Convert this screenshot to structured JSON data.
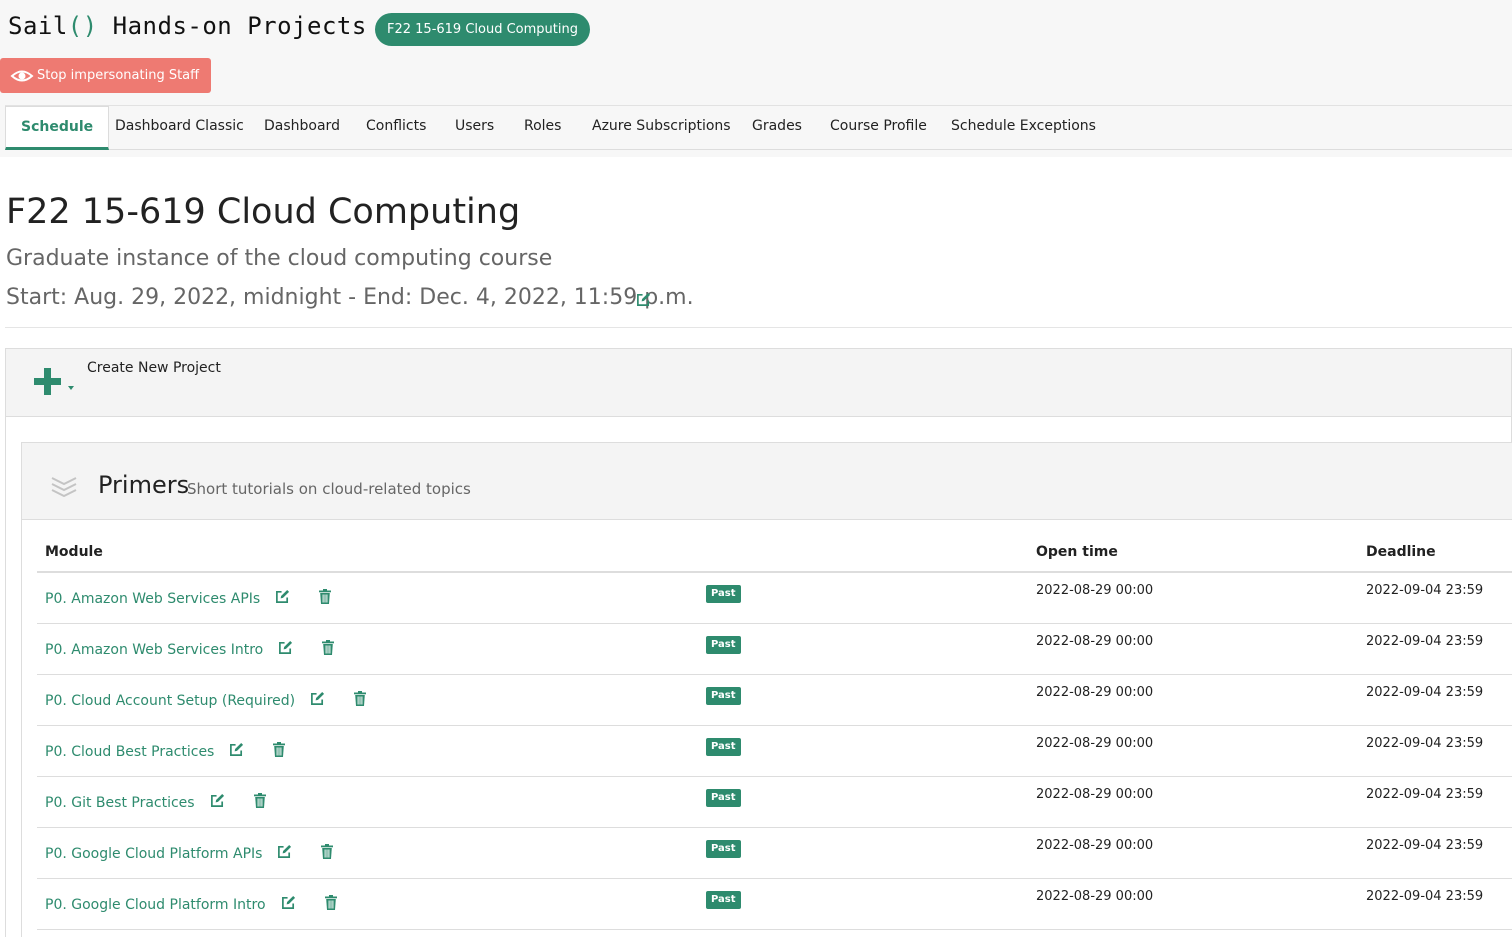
{
  "app": {
    "brand_prefix": "Sail",
    "brand_parens": "()",
    "brand_suffix": "Hands-on Projects",
    "course_pill": "F22 15-619 Cloud Computing",
    "impersonate_label": "Stop impersonating Staff"
  },
  "tabs": [
    {
      "label": "Schedule",
      "active": true
    },
    {
      "label": "Dashboard Classic",
      "active": false
    },
    {
      "label": "Dashboard",
      "active": false
    },
    {
      "label": "Conflicts",
      "active": false
    },
    {
      "label": "Users",
      "active": false
    },
    {
      "label": "Roles",
      "active": false
    },
    {
      "label": "Azure Subscriptions",
      "active": false
    },
    {
      "label": "Grades",
      "active": false
    },
    {
      "label": "Course Profile",
      "active": false
    },
    {
      "label": "Schedule Exceptions",
      "active": false
    }
  ],
  "course": {
    "title": "F22 15-619 Cloud Computing",
    "subtitle": "Graduate instance of the cloud computing course",
    "dates": "Start: Aug. 29, 2022, midnight - End: Dec. 4, 2022, 11:59 p.m."
  },
  "create": {
    "label": "Create New Project"
  },
  "group": {
    "title": "Primers",
    "description": "Short tutorials on cloud-related topics"
  },
  "table": {
    "headers": {
      "module": "Module",
      "open_time": "Open time",
      "deadline": "Deadline"
    },
    "rows": [
      {
        "name": "P0. Amazon Web Services APIs",
        "status": "Past",
        "open": "2022-08-29 00:00",
        "deadline": "2022-09-04 23:59"
      },
      {
        "name": "P0. Amazon Web Services Intro",
        "status": "Past",
        "open": "2022-08-29 00:00",
        "deadline": "2022-09-04 23:59"
      },
      {
        "name": "P0. Cloud Account Setup (Required)",
        "status": "Past",
        "open": "2022-08-29 00:00",
        "deadline": "2022-09-04 23:59"
      },
      {
        "name": "P0. Cloud Best Practices",
        "status": "Past",
        "open": "2022-08-29 00:00",
        "deadline": "2022-09-04 23:59"
      },
      {
        "name": "P0. Git Best Practices",
        "status": "Past",
        "open": "2022-08-29 00:00",
        "deadline": "2022-09-04 23:59"
      },
      {
        "name": "P0. Google Cloud Platform APIs",
        "status": "Past",
        "open": "2022-08-29 00:00",
        "deadline": "2022-09-04 23:59"
      },
      {
        "name": "P0. Google Cloud Platform Intro",
        "status": "Past",
        "open": "2022-08-29 00:00",
        "deadline": "2022-09-04 23:59"
      }
    ]
  },
  "icons": {
    "impersonate": "eye-icon",
    "edit": "edit-icon",
    "delete": "trash-icon",
    "create": "plus-icon",
    "group": "layers-icon"
  },
  "colors": {
    "accent": "#2e8b6e",
    "danger": "#ee7a72"
  }
}
